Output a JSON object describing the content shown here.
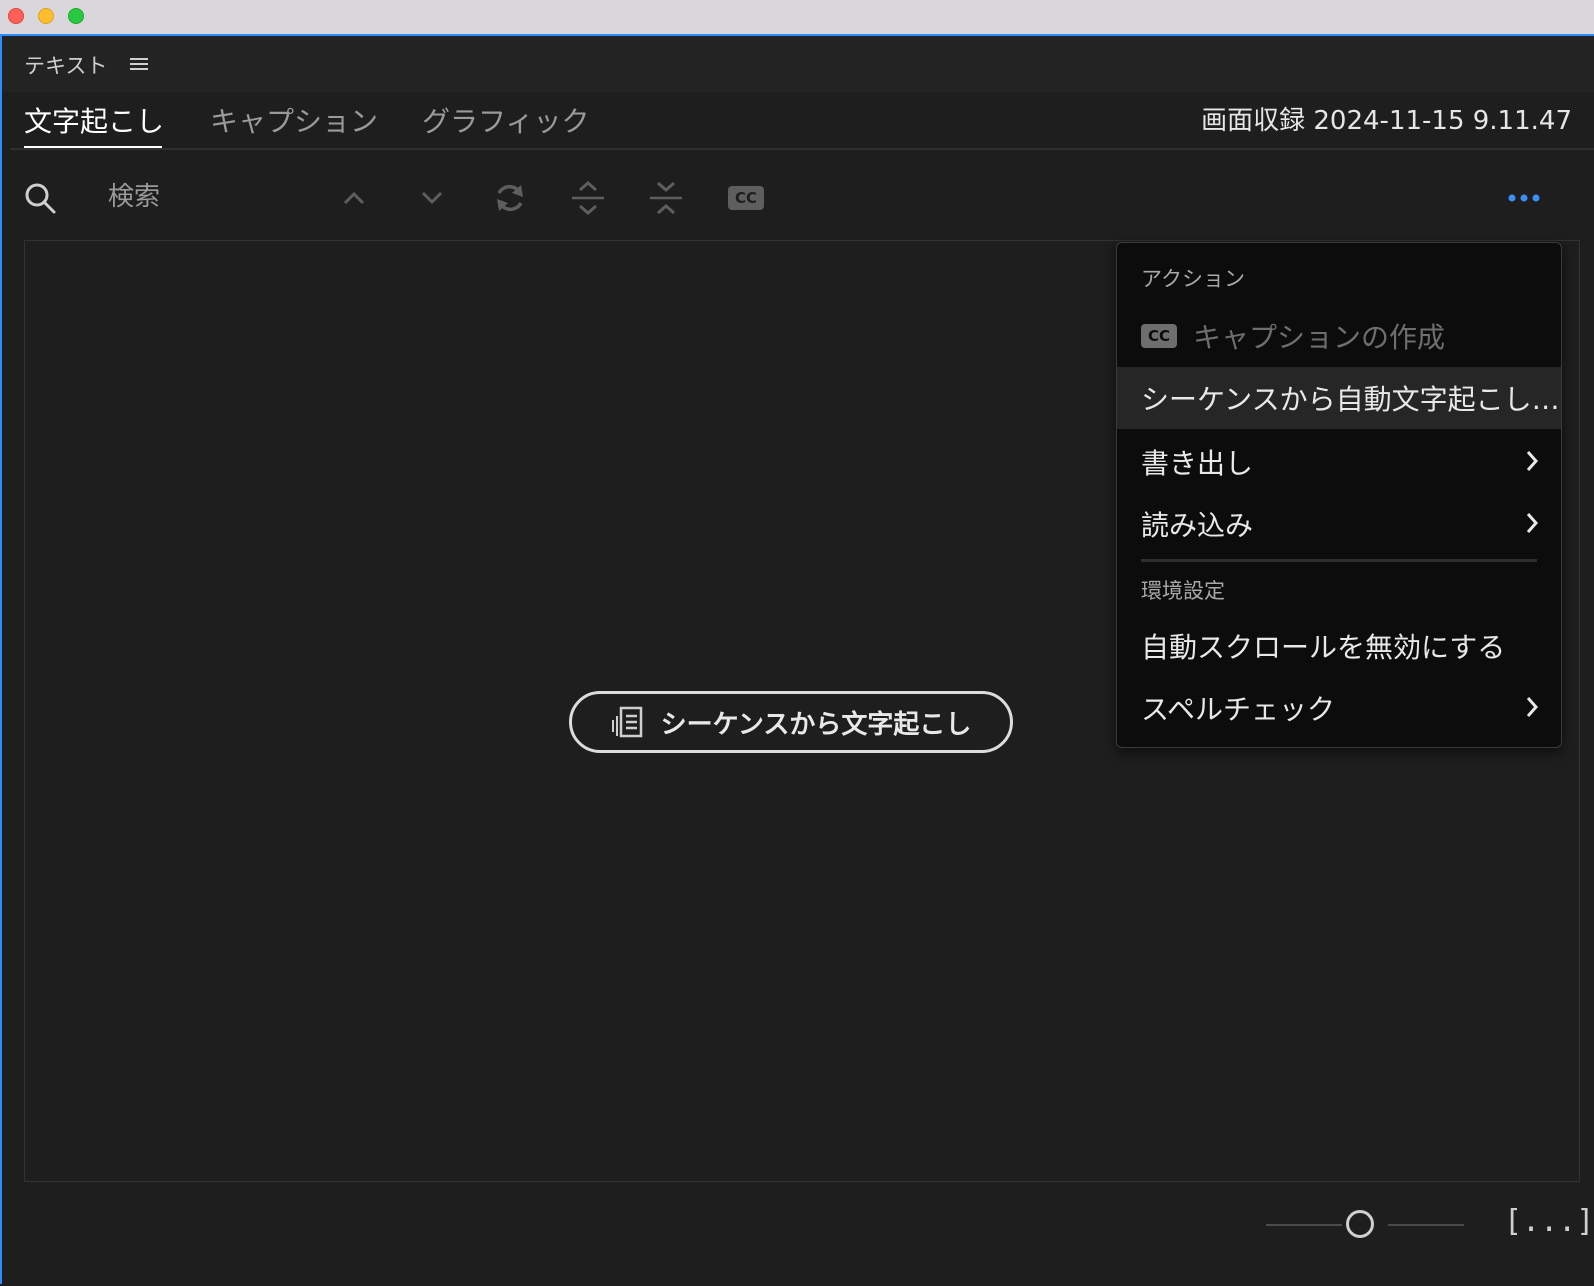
{
  "panel": {
    "title": "テキスト"
  },
  "tabs": [
    {
      "label": "文字起こし",
      "active": true
    },
    {
      "label": "キャプション",
      "active": false
    },
    {
      "label": "グラフィック",
      "active": false
    }
  ],
  "sequence_name": "画面収録 2024-11-15 9.11.47",
  "search": {
    "placeholder": "検索"
  },
  "toolbar_icons": [
    "search-icon",
    "chevron-up-icon",
    "chevron-down-icon",
    "refresh-icon",
    "expand-icon",
    "collapse-icon",
    "cc-icon",
    "more-icon"
  ],
  "content": {
    "transcribe_button_label": "シーケンスから文字起こし"
  },
  "menu": {
    "section_actions": "アクション",
    "create_captions": "キャプションの作成",
    "create_captions_badge": "CC",
    "auto_transcribe": "シーケンスから自動文字起こし…",
    "export": "書き出し",
    "import": "読み込み",
    "section_preferences": "環境設定",
    "disable_autoscroll": "自動スクロールを無効にする",
    "spellcheck": "スペルチェック"
  },
  "toolbar_cc_label": "CC",
  "footer": {
    "fit_label": "[...]"
  },
  "colors": {
    "accent": "#2d8cff",
    "background": "#1e1e1e",
    "menu_background": "#0c0c0c"
  }
}
